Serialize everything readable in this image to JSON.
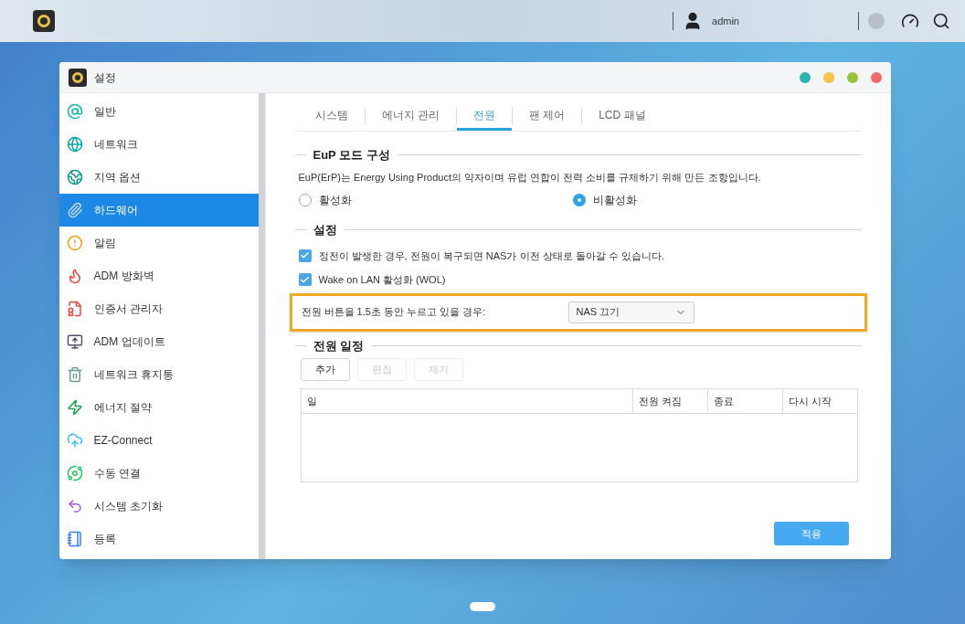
{
  "top_bar": {
    "user": "admin"
  },
  "window": {
    "title": "설정"
  },
  "sidebar": {
    "items": [
      {
        "label": "일반",
        "selected": false
      },
      {
        "label": "네트워크",
        "selected": false
      },
      {
        "label": "지역 옵션",
        "selected": false
      },
      {
        "label": "하드웨어",
        "selected": true
      },
      {
        "label": "알림",
        "selected": false
      },
      {
        "label": "ADM 방화벽",
        "selected": false
      },
      {
        "label": "인증서 관리자",
        "selected": false
      },
      {
        "label": "ADM 업데이트",
        "selected": false
      },
      {
        "label": "네트워크 휴지통",
        "selected": false
      },
      {
        "label": "에너지 절약",
        "selected": false
      },
      {
        "label": "EZ-Connect",
        "selected": false
      },
      {
        "label": "수동 연결",
        "selected": false
      },
      {
        "label": "시스템 초기화",
        "selected": false
      },
      {
        "label": "등록",
        "selected": false
      }
    ]
  },
  "tabs": [
    {
      "label": "시스템",
      "selected": false
    },
    {
      "label": "에너지 관리",
      "selected": false
    },
    {
      "label": "전원",
      "selected": true
    },
    {
      "label": "팬 제어",
      "selected": false
    },
    {
      "label": "LCD 패널",
      "selected": false
    }
  ],
  "eup": {
    "title": "EuP 모드 구성",
    "description": "EuP(ErP)는 Energy Using Product의 약자이며 유럽 연합이 전력 소비를 규제하기 위해 만든 조항입니다.",
    "options": [
      {
        "label": "활성화",
        "selected": false
      },
      {
        "label": "비활성화",
        "selected": true
      }
    ]
  },
  "settings": {
    "title": "설정",
    "checkboxes": [
      {
        "label": "정전이 발생한 경우, 전원이 복구되면 NAS가 이전 상태로 돌아갈 수 있습니다.",
        "checked": true
      },
      {
        "label": "Wake on LAN 활성화 (WOL)",
        "checked": true
      }
    ],
    "power_button": {
      "label": "전원 버튼을 1.5초 동안 누르고 있을 경우:",
      "value": "NAS 끄기"
    }
  },
  "schedule": {
    "title": "전원 일정",
    "buttons": [
      {
        "label": "추가",
        "disabled": false
      },
      {
        "label": "편집",
        "disabled": true
      },
      {
        "label": "제거",
        "disabled": true
      }
    ],
    "table": {
      "columns": [
        "일",
        "전원 켜짐",
        "종료",
        "다시 시작"
      ]
    }
  },
  "apply_button": "적용"
}
